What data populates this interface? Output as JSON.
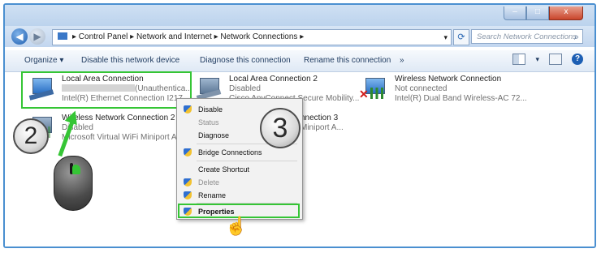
{
  "window": {
    "controls": {
      "minimize": "–",
      "maximize": "□",
      "close": "x"
    }
  },
  "address_bar": {
    "back_glyph": "◀",
    "forward_glyph": "▶",
    "breadcrumb": "▸ Control Panel ▸ Network and Internet ▸ Network Connections ▸",
    "dropdown_glyph": "▾",
    "refresh_glyph": "⟳",
    "search_placeholder": "Search Network Connections",
    "search_icon_glyph": "⌕"
  },
  "toolbar": {
    "organize": "Organize ▾",
    "disable_device": "Disable this network device",
    "diagnose": "Diagnose this connection",
    "rename": "Rename this connection",
    "more": "»",
    "help_glyph": "?"
  },
  "connections": [
    {
      "name": "Local Area Connection",
      "status": "(Unauthentica...",
      "adapter": "Intel(R) Ethernet Connection I217"
    },
    {
      "name": "Local Area Connection 2",
      "status": "Disabled",
      "adapter": "Cisco AnyConnect Secure Mobility..."
    },
    {
      "name": "Wireless Network Connection",
      "status": "Not connected",
      "adapter": "Intel(R) Dual Band Wireless-AC 72..."
    },
    {
      "name": "Wireless Network Connection 2",
      "status": "Disabled",
      "adapter": "Microsoft Virtual WiFi Miniport A..."
    },
    {
      "name": "nnection 3",
      "status": "",
      "adapter": "Miniport A..."
    }
  ],
  "context_menu": {
    "items": [
      {
        "label": "Disable",
        "state": "normal",
        "icon": "shield-icon"
      },
      {
        "label": "Status",
        "state": "disabled"
      },
      {
        "label": "Diagnose",
        "state": "normal"
      },
      {
        "label": "Bridge Connections",
        "state": "normal",
        "icon": "shield-icon"
      },
      {
        "label": "Create Shortcut",
        "state": "normal"
      },
      {
        "label": "Delete",
        "state": "disabled",
        "icon": "shield-icon"
      },
      {
        "label": "Rename",
        "state": "normal",
        "icon": "shield-icon"
      },
      {
        "label": "Properties",
        "state": "bold",
        "icon": "shield-icon"
      }
    ]
  },
  "annotations": {
    "step_two": "2",
    "step_three": "3",
    "highlight_color": "#35c535"
  }
}
